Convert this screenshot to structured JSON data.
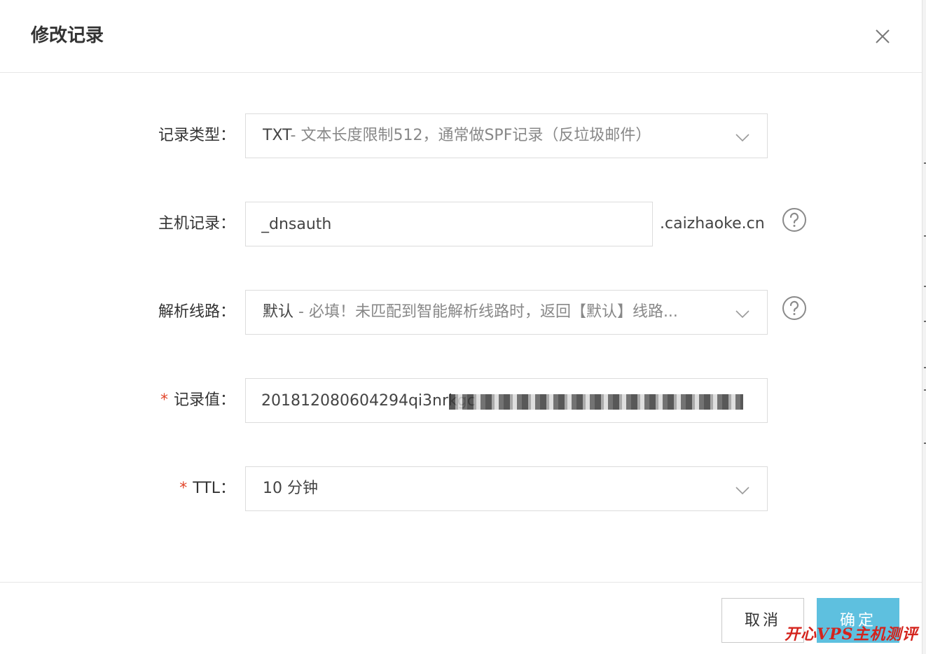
{
  "dialog": {
    "title": "修改记录"
  },
  "form": {
    "record_type": {
      "label": "记录类型：",
      "value_main": "TXT",
      "value_sub": "- 文本长度限制512，通常做SPF记录（反垃圾邮件）"
    },
    "host": {
      "label": "主机记录：",
      "value": "_dnsauth",
      "suffix": ".caizhaoke.cn"
    },
    "line": {
      "label": "解析线路：",
      "value_main": "默认",
      "value_sub": " - 必填！未匹配到智能解析线路时，返回【默认】线路..."
    },
    "record_value": {
      "required_mark": "*",
      "label": "记录值：",
      "value": "201812080604294qi3nrkgc"
    },
    "ttl": {
      "required_mark": "*",
      "label": "TTL：",
      "value": "10 分钟"
    }
  },
  "footer": {
    "cancel_label": "取消",
    "ok_label": "确定"
  },
  "watermark": {
    "text": "开心VPS主机测评",
    "color": "#d4231c"
  },
  "colors": {
    "primary": "#5ec0df",
    "required": "#e2452a",
    "border": "#dcdcdc"
  }
}
